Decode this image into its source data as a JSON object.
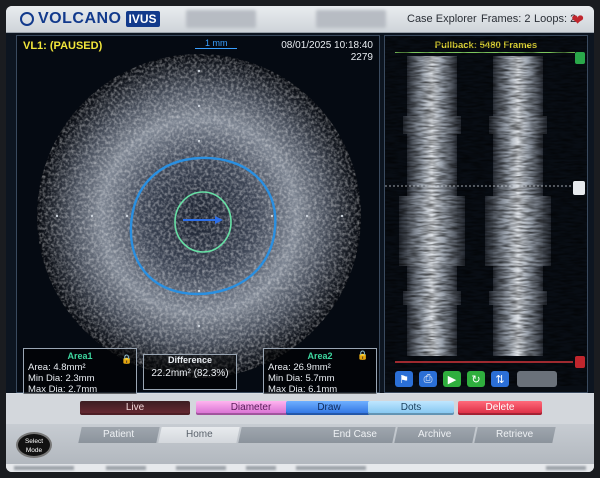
{
  "header": {
    "logo_text": "VOLCANO",
    "logo_badge": "IVUS",
    "case_explorer": "Case Explorer",
    "frames": "Frames: 2",
    "loops": "Loops: 2"
  },
  "image_panel": {
    "status": "VL1: (PAUSED)",
    "scale": "1 mm",
    "date_time": "08/01/2025 10:18:40",
    "frame_number": "2279"
  },
  "area1": {
    "title": "Area1",
    "area": "Area: 4.8mm²",
    "min_dia": "Min Dia: 2.3mm",
    "max_dia": "Max Dia: 2.7mm"
  },
  "area2": {
    "title": "Area2",
    "area": "Area: 26.9mm²",
    "min_dia": "Min Dia: 5.7mm",
    "max_dia": "Max Dia: 6.1mm"
  },
  "difference": {
    "title": "Difference",
    "value": "22.2mm² (82.3%)"
  },
  "pullback": {
    "title": "Pullback: 5480 Frames"
  },
  "tools": {
    "live": "Live",
    "diameter": "Diameter",
    "draw": "Draw",
    "dots": "Dots",
    "delete": "Delete"
  },
  "nav": {
    "select_mode_line1": "Select",
    "select_mode_line2": "Mode",
    "patient": "Patient",
    "home": "Home",
    "end_case": "End Case",
    "archive": "Archive",
    "retrieve": "Retrieve"
  },
  "colors": {
    "status_yellow": "#f1e63b",
    "measure_teal": "#3ed7a0",
    "contour_blue": "#2a8fe0",
    "contour_green": "#67e0a5",
    "live_red": "#c0262d"
  }
}
